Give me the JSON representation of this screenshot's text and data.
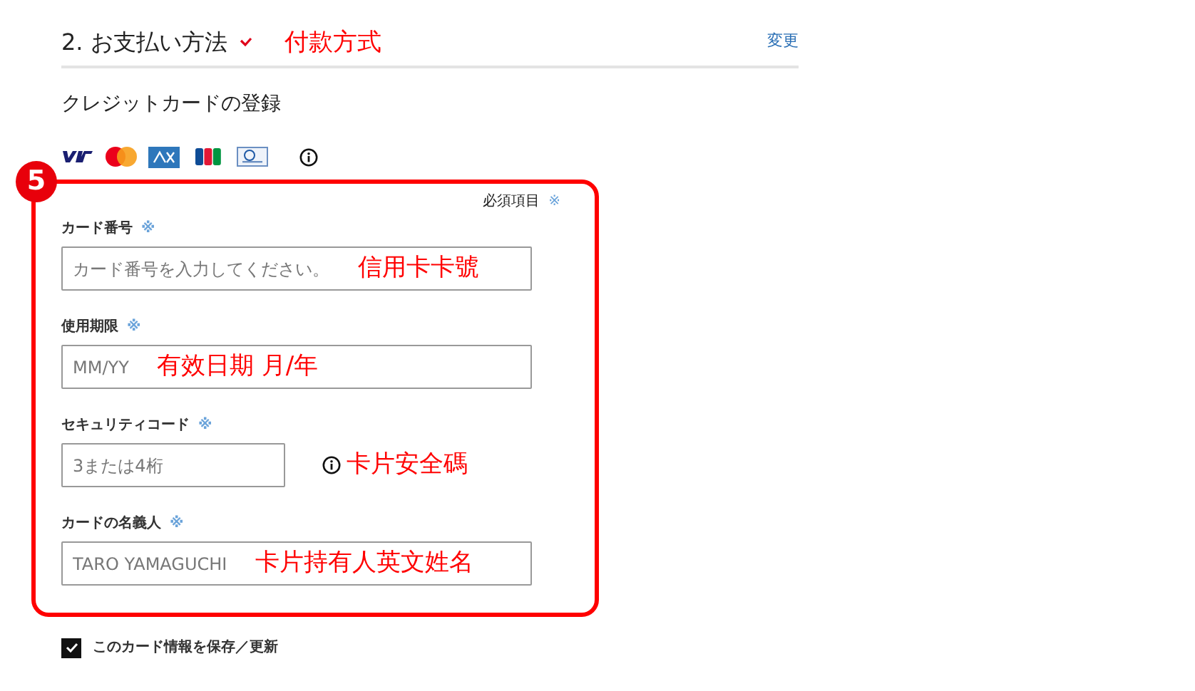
{
  "section": {
    "title": "2. お支払い方法",
    "completed": true,
    "annotation": "付款方式",
    "change_link": "変更"
  },
  "subtitle": "クレジットカードの登録",
  "form": {
    "badge": "5",
    "required_note": "必須項目",
    "required_mark": "※",
    "fields": [
      {
        "kind": "wide",
        "label": "カード番号",
        "required_mark": "※",
        "placeholder": "カード番号を入力してください。",
        "annotation": "信用卡卡號"
      },
      {
        "kind": "wide",
        "label": "使用期限",
        "required_mark": "※",
        "placeholder": "MM/YY",
        "annotation": "有效日期 月/年"
      },
      {
        "kind": "short",
        "label": "セキュリティコード",
        "required_mark": "※",
        "placeholder": "3または4桁",
        "annotation": "卡片安全碼"
      },
      {
        "kind": "wide",
        "label": "カードの名義人",
        "required_mark": "※",
        "placeholder": "TARO YAMAGUCHI",
        "annotation": "卡片持有人英文姓名"
      }
    ]
  },
  "save_card": {
    "label": "このカード情報を保存／更新",
    "checked": true
  }
}
